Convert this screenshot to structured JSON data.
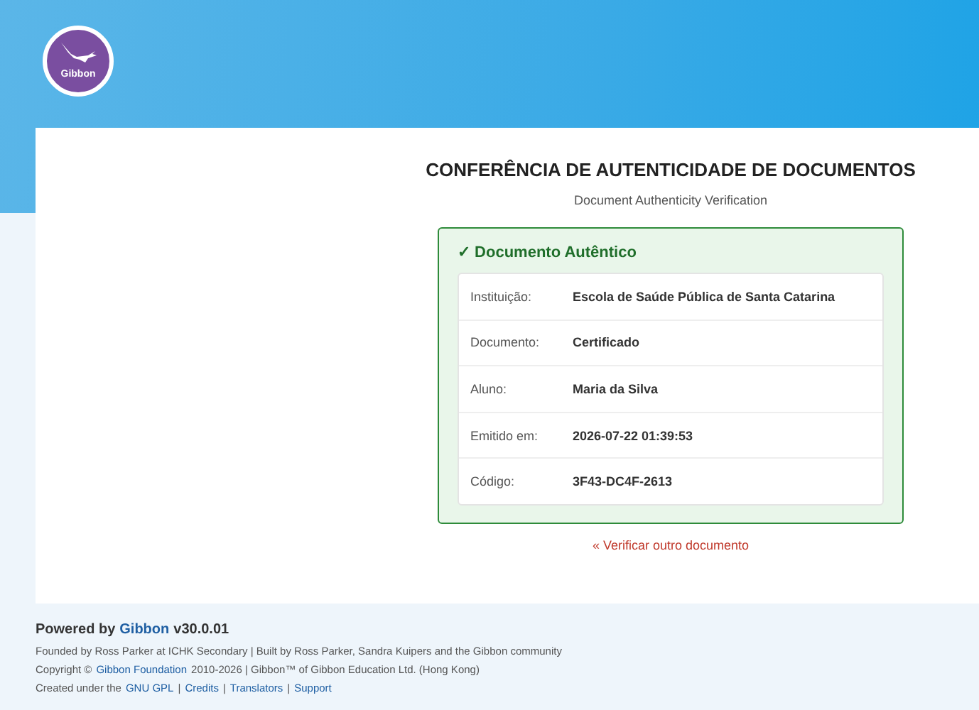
{
  "logo": {
    "text": "Gibbon"
  },
  "page": {
    "title": "CONFERÊNCIA DE AUTENTICIDADE DE DOCUMENTOS",
    "subtitle": "Document Authenticity Verification"
  },
  "result": {
    "status": "✓ Documento Autêntico",
    "valid": true,
    "fields": [
      {
        "label": "Instituição:",
        "value": "Escola de Saúde Pública de Santa Catarina"
      },
      {
        "label": "Documento:",
        "value": "Certificado"
      },
      {
        "label": "Aluno:",
        "value": "Maria da Silva"
      },
      {
        "label": "Emitido em:",
        "value": "2026-07-22 01:39:53"
      },
      {
        "label": "Código:",
        "value": "3F43-DC4F-2613"
      }
    ]
  },
  "back_link": "« Verificar outro documento",
  "footer": {
    "powered": [
      {
        "kind": "text",
        "text": "Powered by"
      },
      {
        "kind": "link",
        "text": "Gibbon"
      },
      {
        "kind": "text",
        "text": "v30.0.01"
      }
    ],
    "lines": [
      [
        {
          "kind": "text",
          "text": "Founded by Ross Parker at ICHK Secondary | Built by Ross Parker, Sandra Kuipers and the Gibbon community"
        }
      ],
      [
        {
          "kind": "text",
          "text": "Copyright ©"
        },
        {
          "kind": "link",
          "text": "Gibbon Foundation"
        },
        {
          "kind": "text",
          "text": "2010-2026 | Gibbon™ of Gibbon Education Ltd. (Hong Kong)"
        }
      ],
      [
        {
          "kind": "text",
          "text": "Created under the"
        },
        {
          "kind": "link",
          "text": "GNU GPL"
        },
        {
          "kind": "text",
          "text": "|"
        },
        {
          "kind": "link",
          "text": "Credits"
        },
        {
          "kind": "text",
          "text": "|"
        },
        {
          "kind": "link",
          "text": "Translators"
        },
        {
          "kind": "text",
          "text": "|"
        },
        {
          "kind": "link",
          "text": "Support"
        }
      ]
    ]
  }
}
